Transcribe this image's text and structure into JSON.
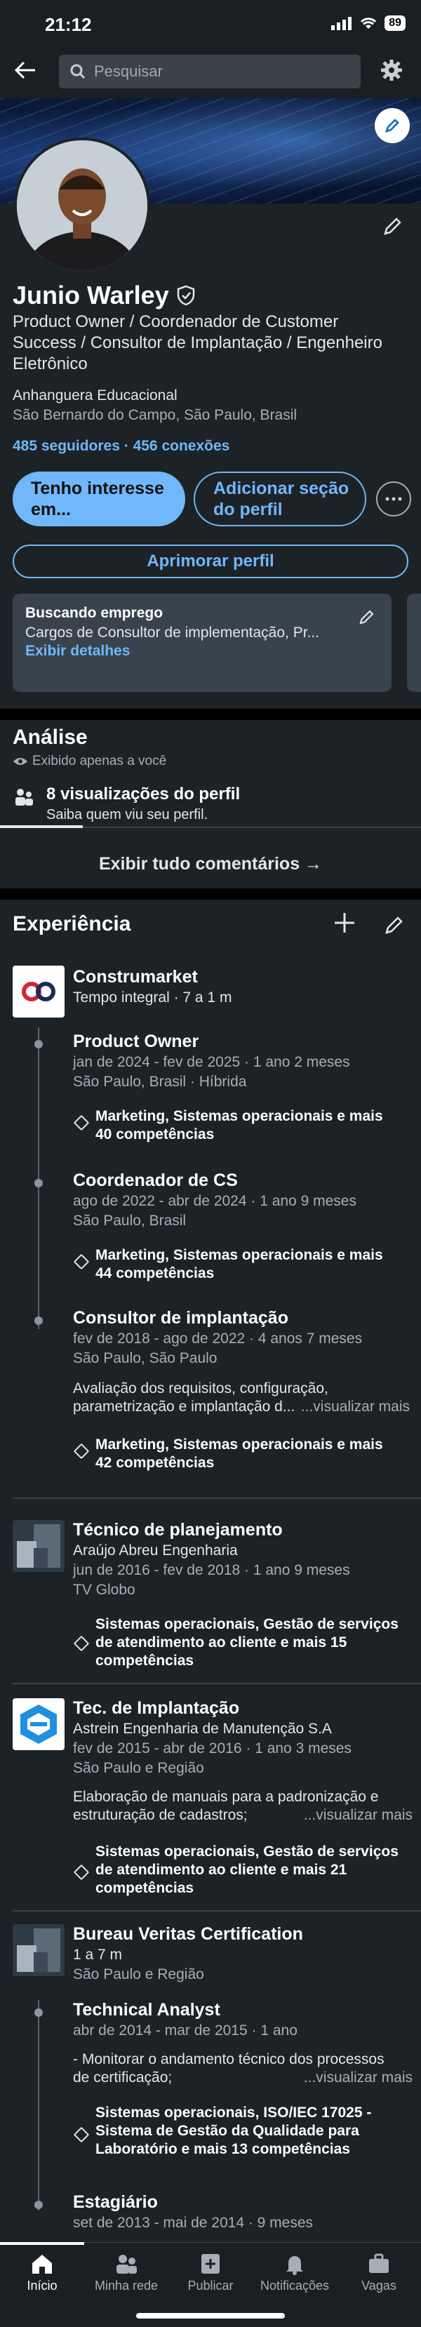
{
  "status": {
    "time": "21:12",
    "battery": "89"
  },
  "search": {
    "placeholder": "Pesquisar"
  },
  "profile": {
    "name": "Junio Warley",
    "headline": "Product Owner / Coordenador de Customer Success / Consultor de Implantação / Engenheiro Eletrônico",
    "company": "Anhanguera Educacional",
    "location": "São Bernardo do Campo, São Paulo, Brasil",
    "followers": "485 seguidores · 456 conexões",
    "btn_interest": "Tenho interesse em...",
    "btn_add_section": "Adicionar seção do perfil",
    "btn_improve": "Aprimorar perfil",
    "job_card": {
      "title": "Buscando emprego",
      "text": "Cargos de Consultor de implementação, Pr...",
      "link": "Exibir detalhes"
    }
  },
  "analysis": {
    "title": "Análise",
    "visibility": "Exibido apenas a você",
    "views": "8 visualizações do perfil",
    "views_sub": "Saiba quem viu seu perfil."
  },
  "show_all": "Exibir tudo comentários →",
  "experience": {
    "title": "Experiência",
    "construmarket": {
      "company": "Construmarket",
      "summary": "Tempo integral · 7 a 1 m",
      "roles": [
        {
          "title": "Product Owner",
          "dates": "jan de 2024 - fev de 2025 · 1 ano 2 meses",
          "place": "São Paulo, Brasil · Híbrida",
          "skills1": "Marketing, Sistemas operacionais e mais",
          "skills2": "40 competências"
        },
        {
          "title": "Coordenador de CS",
          "dates": "ago de 2022 - abr de 2024 · 1 ano 9 meses",
          "place": "São Paulo, Brasil",
          "skills1": "Marketing, Sistemas operacionais e mais",
          "skills2": "44 competências"
        },
        {
          "title": "Consultor de implantação",
          "dates": "fev de 2018 - ago de 2022 · 4 anos 7 meses",
          "place": "São Paulo, São Paulo",
          "desc1": "Avaliação dos requisitos, configuração,",
          "desc2": "parametrização e implantação d...",
          "more": "...visualizar mais",
          "skills1": "Marketing, Sistemas operacionais e mais",
          "skills2": "42 competências"
        }
      ]
    },
    "araujo": {
      "title": "Técnico de planejamento",
      "company": "Araújo Abreu Engenharia",
      "dates": "jun de 2016 - fev de 2018 · 1 ano 9 meses",
      "place": "TV Globo",
      "skills1": "Sistemas operacionais, Gestão de serviços",
      "skills2": "de atendimento ao cliente e mais 15",
      "skills3": "competências"
    },
    "astrein": {
      "title": "Tec. de Implantação",
      "company": "Astrein Engenharia de Manutenção S.A",
      "dates": "fev de 2015 - abr de 2016 · 1 ano 3 meses",
      "place": "São Paulo e Região",
      "desc1": "Elaboração de manuais para a padronização e",
      "desc2": "estruturação de cadastros;",
      "more": "...visualizar mais",
      "skills1": "Sistemas operacionais, Gestão de serviços",
      "skills2": "de atendimento ao cliente e mais 21",
      "skills3": "competências"
    },
    "bureau": {
      "company": "Bureau Veritas Certification",
      "summary": "1 a 7 m",
      "place": "São Paulo e Região",
      "roles": [
        {
          "title": "Technical Analyst",
          "dates": "abr de 2014 - mar de 2015 · 1 ano",
          "desc1": "- Monitorar o andamento técnico dos processos",
          "desc2": "de certificação;",
          "more": "...visualizar mais",
          "skills1": "Sistemas operacionais, ISO/IEC 17025 -",
          "skills2": "Sistema de Gestão da Qualidade para",
          "skills3": "Laboratório e mais 13 competências"
        },
        {
          "title": "Estagiário",
          "dates": "set de 2013 - mai de 2014 · 9 meses"
        }
      ]
    }
  },
  "nav": [
    {
      "label": "Início",
      "icon": "home-icon"
    },
    {
      "label": "Minha rede",
      "icon": "network-icon"
    },
    {
      "label": "Publicar",
      "icon": "post-icon"
    },
    {
      "label": "Notificações",
      "icon": "bell-icon"
    },
    {
      "label": "Vagas",
      "icon": "briefcase-icon"
    }
  ]
}
